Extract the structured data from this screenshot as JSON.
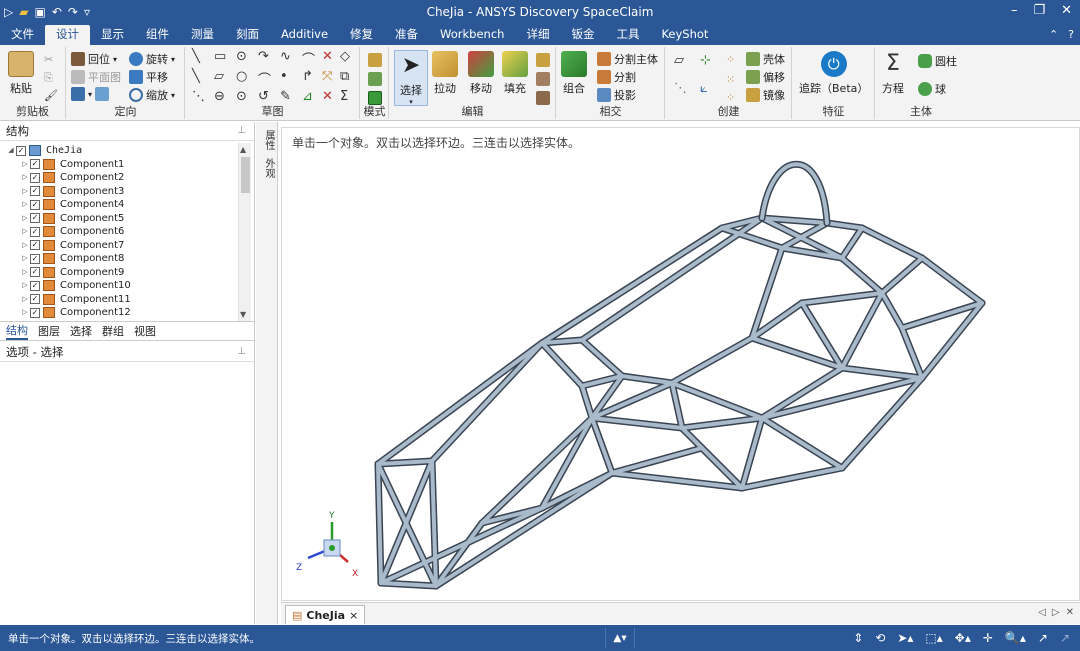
{
  "app": {
    "title": "CheJia - ANSYS Discovery SpaceClaim"
  },
  "tabs": [
    "文件",
    "设计",
    "显示",
    "组件",
    "测量",
    "刻面",
    "Additive",
    "修复",
    "准备",
    "Workbench",
    "详细",
    "钣金",
    "工具",
    "KeyShot"
  ],
  "active_tab": "设计",
  "ribbon": {
    "clipboard": {
      "paste": "粘贴",
      "label": "剪贴板"
    },
    "orient": {
      "home": "回位",
      "plan": "平面图",
      "rotate": "旋转",
      "pan": "平移",
      "zoom": "缩放",
      "label": "定向"
    },
    "sketch": {
      "label": "草图"
    },
    "mode": {
      "label": "模式"
    },
    "edit": {
      "select": "选择",
      "pull": "拉动",
      "move": "移动",
      "fill": "填充",
      "label": "编辑"
    },
    "intersect": {
      "combine": "组合",
      "split_body": "分割主体",
      "split": "分割",
      "project": "投影",
      "label": "相交"
    },
    "create": {
      "shell": "壳体",
      "offset": "偏移",
      "mirror": "镜像",
      "label": "创建"
    },
    "feature": {
      "track": "追踪（Beta）",
      "label": "特征"
    },
    "body": {
      "equation": "方程",
      "cylinder": "圆柱",
      "sphere": "球",
      "label": "主体"
    }
  },
  "structure_panel": {
    "title": "结构",
    "root": "CheJia",
    "components": [
      "Component1",
      "Component2",
      "Component3",
      "Component4",
      "Component5",
      "Component6",
      "Component7",
      "Component8",
      "Component9",
      "Component10",
      "Component11",
      "Component12"
    ],
    "tabs": [
      "结构",
      "图层",
      "选择",
      "群组",
      "视图"
    ]
  },
  "options_panel": {
    "title": "选项 - 选择"
  },
  "side_tabs": [
    "属性",
    "外观"
  ],
  "viewport": {
    "hint": "单击一个对象。双击以选择环边。三连击以选择实体。",
    "triad": {
      "x": "X",
      "y": "Y",
      "z": "Z"
    }
  },
  "document_tab": "CheJia",
  "status_bar": {
    "message": "单击一个对象。双击以选择环边。三连击以选择实体。"
  }
}
